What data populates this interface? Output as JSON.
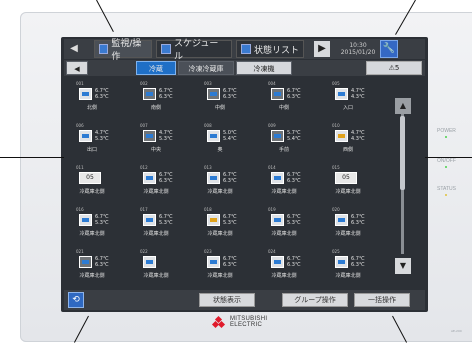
{
  "header": {
    "tabs": [
      {
        "label": "監視/操作",
        "active": true
      },
      {
        "label": "スケジュール",
        "active": false
      },
      {
        "label": "状態リスト",
        "active": false
      }
    ],
    "nav_left": "◀",
    "nav_right": "▶",
    "datetime": "10:30 2015/01/20",
    "wrench_icon": "wrench-icon"
  },
  "subtabs": {
    "left_arrow": "◀",
    "items": [
      "冷蔵",
      "冷凍冷蔵庫",
      "冷凍機"
    ],
    "warning": "⚠5"
  },
  "units": [
    {
      "num": "001",
      "name": "北側",
      "t1": "6.7℃",
      "t2": "6.3℃",
      "icon": "blue"
    },
    {
      "num": "002",
      "name": "南側",
      "t1": "6.7℃",
      "t2": "6.3℃",
      "icon": "dark"
    },
    {
      "num": "003",
      "name": "中側",
      "t1": "6.7℃",
      "t2": "6.3℃",
      "icon": "dark"
    },
    {
      "num": "004",
      "name": "中側",
      "t1": "6.7℃",
      "t2": "6.3℃",
      "icon": "dark"
    },
    {
      "num": "005",
      "name": "入口",
      "t1": "4.7℃",
      "t2": "4.3℃",
      "icon": "blue"
    },
    {
      "num": "006",
      "name": "出口",
      "t1": "4.7℃",
      "t2": "5.3℃",
      "icon": "blue"
    },
    {
      "num": "007",
      "name": "中央",
      "t1": "4.7℃",
      "t2": "5.3℃",
      "icon": "dark"
    },
    {
      "num": "008",
      "name": "奥",
      "t1": "5.0℃",
      "t2": "5.4℃",
      "icon": "blue"
    },
    {
      "num": "009",
      "name": "手前",
      "t1": "5.7℃",
      "t2": "5.4℃",
      "icon": "dark"
    },
    {
      "num": "010",
      "name": "西側",
      "t1": "4.7℃",
      "t2": "4.3℃",
      "icon": "orange"
    },
    {
      "num": "011",
      "name": "冷蔵庫北側",
      "t1": "05",
      "t2": "",
      "icon": "badge"
    },
    {
      "num": "012",
      "name": "冷蔵庫北側",
      "t1": "6.7℃",
      "t2": "6.3℃",
      "icon": "blue"
    },
    {
      "num": "013",
      "name": "冷蔵庫北側",
      "t1": "6.7℃",
      "t2": "6.3℃",
      "icon": "blue"
    },
    {
      "num": "014",
      "name": "冷蔵庫北側",
      "t1": "6.7℃",
      "t2": "6.3℃",
      "icon": "blue"
    },
    {
      "num": "015",
      "name": "冷蔵庫北側",
      "t1": "05",
      "t2": "",
      "icon": "badge"
    },
    {
      "num": "016",
      "name": "冷蔵庫北側",
      "t1": "6.7℃",
      "t2": "5.3℃",
      "icon": "blue"
    },
    {
      "num": "017",
      "name": "冷蔵庫北側",
      "t1": "6.7℃",
      "t2": "5.3℃",
      "icon": "blue"
    },
    {
      "num": "018",
      "name": "冷蔵庫北側",
      "t1": "6.7℃",
      "t2": "5.3℃",
      "icon": "orange"
    },
    {
      "num": "019",
      "name": "冷蔵庫北側",
      "t1": "6.7℃",
      "t2": "5.3℃",
      "icon": "blue"
    },
    {
      "num": "020",
      "name": "冷蔵庫北側",
      "t1": "6.7℃",
      "t2": "6.3℃",
      "icon": "blue"
    },
    {
      "num": "021",
      "name": "冷蔵庫北側",
      "t1": "6.7℃",
      "t2": "6.3℃",
      "icon": "dark"
    },
    {
      "num": "022",
      "name": "冷蔵庫北側",
      "t1": "",
      "t2": "",
      "icon": "blue"
    },
    {
      "num": "023",
      "name": "冷蔵庫北側",
      "t1": "6.7℃",
      "t2": "6.3℃",
      "icon": "blue"
    },
    {
      "num": "024",
      "name": "冷蔵庫北側",
      "t1": "6.7℃",
      "t2": "6.3℃",
      "icon": "blue"
    },
    {
      "num": "025",
      "name": "冷蔵庫北側",
      "t1": "6.7℃",
      "t2": "6.3℃",
      "icon": "blue"
    }
  ],
  "scroll": {
    "up": "▲",
    "down": "▼"
  },
  "bottom": {
    "refresh_icon": "refresh-icon",
    "buttons": [
      "状態表示",
      "グループ操作",
      "一括操作"
    ]
  },
  "brand": {
    "line1": "MITSUBISHI",
    "line2": "ELECTRIC"
  },
  "side": {
    "power": "POWER",
    "onoff": "ON/OFF",
    "status": "STATUS"
  },
  "model": "AE-200"
}
